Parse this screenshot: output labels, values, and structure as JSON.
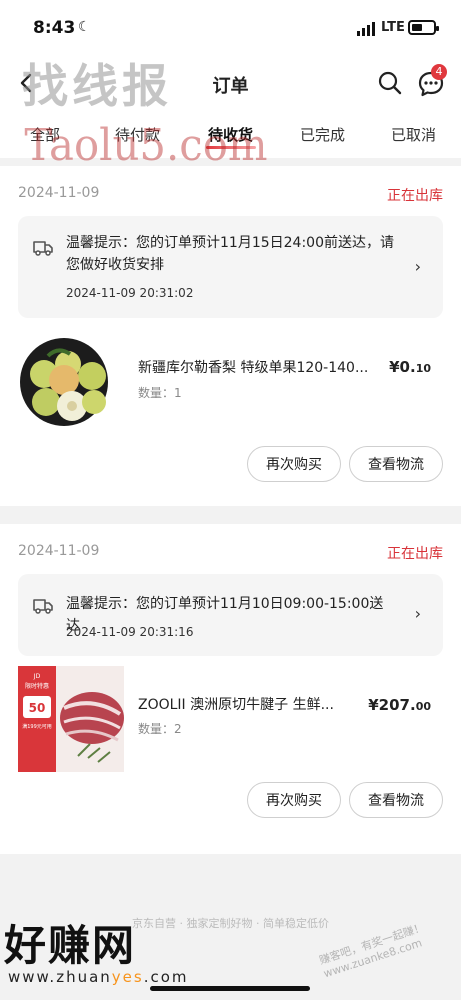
{
  "status_bar": {
    "time": "8:43",
    "network": "LTE"
  },
  "header": {
    "title": "订单",
    "message_badge": "4"
  },
  "tabs": [
    {
      "label": "全部"
    },
    {
      "label": "待付款"
    },
    {
      "label": "待收货",
      "active": true
    },
    {
      "label": "已完成"
    },
    {
      "label": "已取消"
    }
  ],
  "watermarks": {
    "top_cn": "找线报",
    "top_url": "Taolu5.com",
    "bottom_cn": "好赚网",
    "bottom_url_a": "www.zhuan",
    "bottom_url_b": "yes",
    "bottom_url_c": ".com",
    "bottom_stamp": "赚客吧，有奖一起赚！www.zuanke8.com"
  },
  "orders": [
    {
      "date": "2024-11-09",
      "status": "正在出库",
      "notice_text": "温馨提示：您的订单预计11月15日24:00前送达，请您做好收货安排",
      "notice_time": "2024-11-09 20:31:02",
      "product_name": "新疆库尔勒香梨 特级单果120-140...",
      "quantity": "数量：1",
      "price_main": "¥0.",
      "price_cents": "10",
      "buy_again": "再次购买",
      "logistics": "查看物流"
    },
    {
      "date": "2024-11-09",
      "status": "正在出库",
      "notice_text": "温馨提示：您的订单预计11月10日09:00-15:00送达",
      "notice_time": "2024-11-09 20:31:16",
      "product_name": "ZOOLII 澳洲原切牛腱子 生鲜...",
      "quantity": "数量：2",
      "price_main": "¥207.",
      "price_cents": "00",
      "buy_again": "再次购买",
      "logistics": "查看物流"
    }
  ],
  "beef_image": {
    "line1": "JD",
    "line2": "限时特惠",
    "price": "50",
    "coupon": "满199元可用"
  },
  "footer": "京东自营 · 独家定制好物 · 简单稳定低价",
  "colors": {
    "accent": "#d8343a",
    "badge": "#e0383e",
    "background": "#f2f2f2"
  }
}
